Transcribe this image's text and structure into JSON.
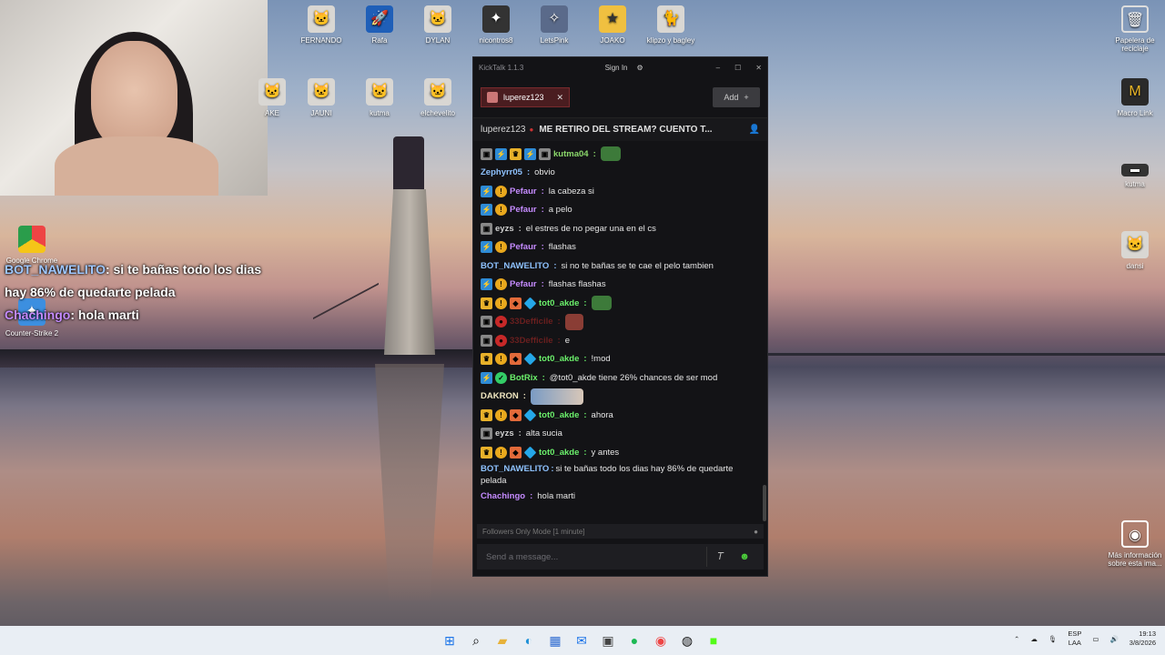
{
  "desktop": {
    "icons_top": [
      {
        "label": "FERNANDO",
        "glyph": "🐱",
        "name": "fernando-icon"
      },
      {
        "label": "Rafa",
        "glyph": "🚀",
        "name": "rocket-league-icon"
      },
      {
        "label": "DYLAN",
        "glyph": "🐱",
        "name": "dylan-icon"
      },
      {
        "label": "nicontros8",
        "glyph": "✦",
        "name": "nicontros-icon"
      },
      {
        "label": "LetsPink",
        "glyph": "✧",
        "name": "counter-strike-icon"
      },
      {
        "label": "JOAKO",
        "glyph": "★",
        "name": "stumble-guys-icon"
      },
      {
        "label": "klipzo y bagley",
        "glyph": "🐈",
        "name": "klipzo-icon"
      }
    ],
    "icons_row2": [
      {
        "label": "AKE",
        "glyph": "🐱",
        "name": "ake-icon"
      },
      {
        "label": "JAUNI",
        "glyph": "🐱",
        "name": "jauni-icon"
      },
      {
        "label": "kutma",
        "glyph": "🐱",
        "name": "kutma-icon"
      },
      {
        "label": "elchevelito",
        "glyph": "🐱",
        "name": "elchevelito-icon"
      }
    ],
    "icons_left": [
      {
        "label": "Google Chrome",
        "name": "chrome-icon"
      },
      {
        "label": "Counter-Strike 2",
        "name": "cs2-icon"
      }
    ],
    "icons_right": [
      {
        "label": "Papelera de reciclaje",
        "glyph": "🗑",
        "name": "recycle-bin-icon"
      },
      {
        "label": "Macro Link",
        "glyph": "M",
        "name": "macro-link-icon"
      },
      {
        "label": "kutma",
        "glyph": "▬",
        "name": "kutma-right-icon"
      },
      {
        "label": "dansi",
        "glyph": "🐱",
        "name": "dansi-icon"
      },
      {
        "label": "Más información sobre esta ima...",
        "glyph": "◉",
        "name": "info-icon"
      }
    ]
  },
  "overlay": {
    "line1_name": "BOT_NAWELITO",
    "line1_text": ": si te bañas todo los dias hay 86% de quedarte pelada",
    "line2_name": "Chachingo",
    "line2_text": ": hola marti"
  },
  "app": {
    "title": "KickTalk 1.1.3",
    "sign_in": "Sign In",
    "tab_label": "luperez123",
    "add_label": "Add",
    "header_user": "luperez123",
    "header_title": "ME RETIRO DEL STREAM? CUENTO T...",
    "followers_mode": "Followers Only Mode [1 minute]",
    "input_placeholder": "Send a message..."
  },
  "messages": [
    {
      "badges": [
        "gray",
        "sub",
        "crown",
        "sub",
        "gray"
      ],
      "user": "kutma04",
      "color": "#8bd86b",
      "text": "",
      "emote": "green"
    },
    {
      "badges": [],
      "user": "Zephyrr05",
      "color": "#8ec2ff",
      "text": "obvio"
    },
    {
      "badges": [
        "sub",
        "gold"
      ],
      "user": "Pefaur",
      "color": "#c58bff",
      "text": "la cabeza si"
    },
    {
      "badges": [
        "sub",
        "gold"
      ],
      "user": "Pefaur",
      "color": "#c58bff",
      "text": "a pelo"
    },
    {
      "badges": [
        "gray"
      ],
      "user": "eyzs",
      "color": "#cfcfcf",
      "text": "el estres de no pegar una en el cs"
    },
    {
      "badges": [
        "sub",
        "gold"
      ],
      "user": "Pefaur",
      "color": "#c58bff",
      "text": "flashas"
    },
    {
      "badges": [],
      "user": "BOT_NAWELITO",
      "color": "#8ec2ff",
      "text": "si no te bañas se te cae el pelo tambien"
    },
    {
      "badges": [
        "sub",
        "gold"
      ],
      "user": "Pefaur",
      "color": "#c58bff",
      "text": "flashas flashas"
    },
    {
      "badges": [
        "crown",
        "gold",
        "orange",
        "diamond"
      ],
      "user": "tot0_akde",
      "color": "#6bf06b",
      "text": "",
      "emote": "green"
    },
    {
      "badges": [
        "gray",
        "red"
      ],
      "user": "33Defficile",
      "color": "#6a1f1f",
      "text": "",
      "emote": "pic"
    },
    {
      "badges": [
        "gray",
        "red"
      ],
      "user": "33Defficile",
      "color": "#6a1f1f",
      "text": "e"
    },
    {
      "badges": [
        "crown",
        "gold",
        "orange",
        "diamond"
      ],
      "user": "tot0_akde",
      "color": "#6bf06b",
      "text": "!mod"
    },
    {
      "badges": [
        "sub",
        "bot"
      ],
      "user": "BotRix",
      "color": "#6bf06b",
      "text": "@tot0_akde tiene 26% chances de ser mod"
    },
    {
      "badges": [],
      "user": "DAKRON",
      "color": "#f0e6c0",
      "text": "",
      "emote": "wide"
    },
    {
      "badges": [
        "crown",
        "gold",
        "orange",
        "diamond"
      ],
      "user": "tot0_akde",
      "color": "#6bf06b",
      "text": "ahora"
    },
    {
      "badges": [
        "gray"
      ],
      "user": "eyzs",
      "color": "#cfcfcf",
      "text": "alta sucia"
    },
    {
      "badges": [
        "crown",
        "gold",
        "orange",
        "diamond"
      ],
      "user": "tot0_akde",
      "color": "#6bf06b",
      "text": "y antes"
    },
    {
      "badges": [],
      "user": "BOT_NAWELITO",
      "color": "#8ec2ff",
      "text": "si te bañas todo los dias hay 86% de quedarte pelada",
      "wrap": true
    },
    {
      "badges": [],
      "user": "Chachingo",
      "color": "#c58bff",
      "text": "hola marti"
    }
  ],
  "taskbar": {
    "lang_top": "ESP",
    "lang_bottom": "LAA",
    "time": "19:13",
    "date": "3/8/2026"
  }
}
